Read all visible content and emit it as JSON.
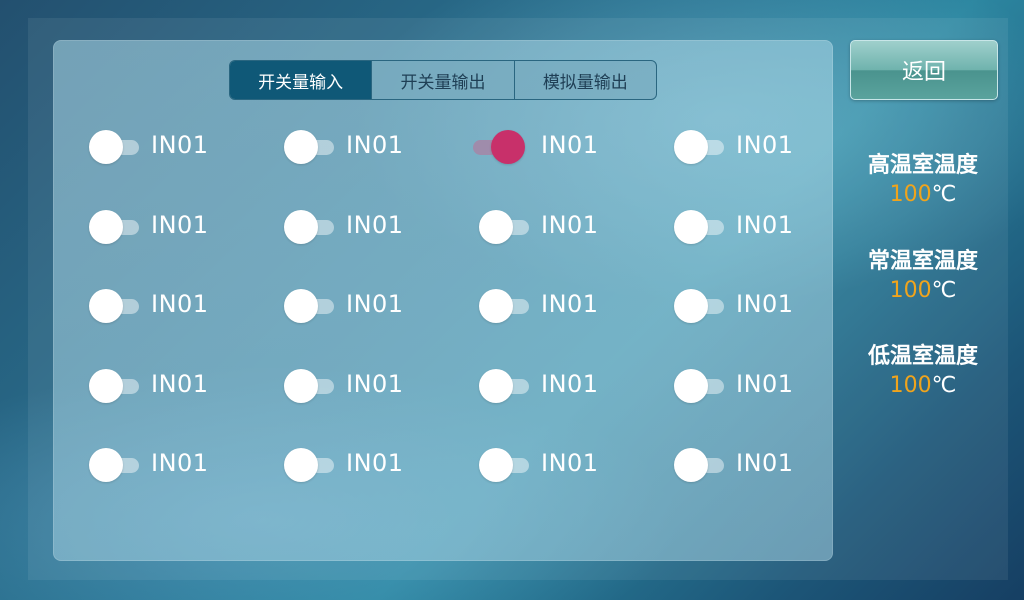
{
  "tabs": [
    {
      "label": "开关量输入",
      "active": true
    },
    {
      "label": "开关量输出",
      "active": false
    },
    {
      "label": "模拟量输出",
      "active": false
    }
  ],
  "inputs": [
    {
      "label": "IN01",
      "on": false
    },
    {
      "label": "IN01",
      "on": false
    },
    {
      "label": "IN01",
      "on": true
    },
    {
      "label": "IN01",
      "on": false
    },
    {
      "label": "IN01",
      "on": false
    },
    {
      "label": "IN01",
      "on": false
    },
    {
      "label": "IN01",
      "on": false
    },
    {
      "label": "IN01",
      "on": false
    },
    {
      "label": "IN01",
      "on": false
    },
    {
      "label": "IN01",
      "on": false
    },
    {
      "label": "IN01",
      "on": false
    },
    {
      "label": "IN01",
      "on": false
    },
    {
      "label": "IN01",
      "on": false
    },
    {
      "label": "IN01",
      "on": false
    },
    {
      "label": "IN01",
      "on": false
    },
    {
      "label": "IN01",
      "on": false
    },
    {
      "label": "IN01",
      "on": false
    },
    {
      "label": "IN01",
      "on": false
    },
    {
      "label": "IN01",
      "on": false
    },
    {
      "label": "IN01",
      "on": false
    }
  ],
  "back_button": {
    "label": "返回"
  },
  "temperatures": [
    {
      "title": "高温室温度",
      "value": "100",
      "unit": "℃"
    },
    {
      "title": "常温室温度",
      "value": "100",
      "unit": "℃"
    },
    {
      "title": "低温室温度",
      "value": "100",
      "unit": "℃"
    }
  ],
  "colors": {
    "toggle_on": "#c8306a",
    "toggle_off": "#ffffff",
    "value_accent": "#f0a41c",
    "active_tab": "#0f5877"
  }
}
